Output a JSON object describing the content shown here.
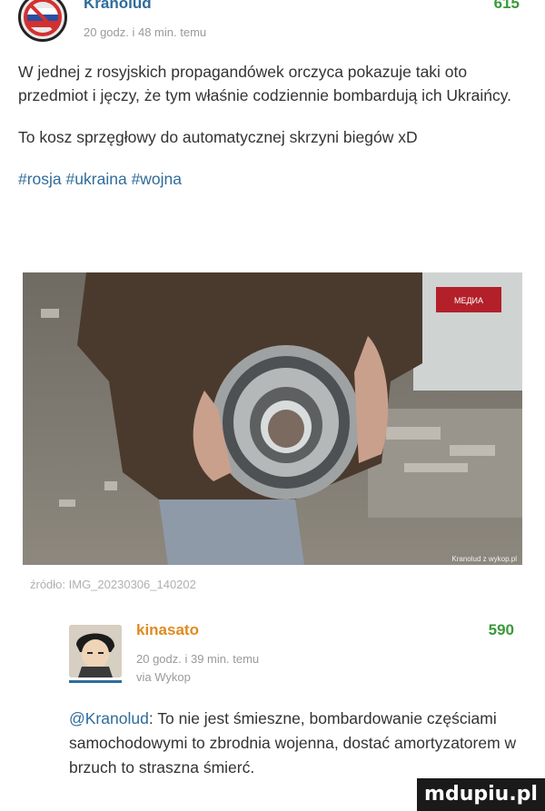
{
  "post": {
    "author": "Kranolud",
    "score": "615",
    "meta": "20 godz. i 48 min. temu",
    "paragraphs": [
      "W jednej z rosyjskich propagandówek orczyca pokazuje taki oto przedmiot i jęczy, że tym właśnie codziennie bombardują ich Ukraińcy.",
      "To kosz sprzęgłowy do automatycznej skrzyni biegów xD"
    ],
    "tags": [
      "#rosja",
      "#ukraina",
      "#wojna"
    ],
    "image": {
      "corner_logo_text": "МЕДИА",
      "watermark": "Kranolud z wykop.pl"
    },
    "source_caption": "źródło: IMG_20230306_140202"
  },
  "comment": {
    "author": "kinasato",
    "score": "590",
    "meta_time": "20 godz. i 39 min. temu",
    "meta_via": "via Wykop",
    "mention": "@Kranolud",
    "text": ": To nie jest śmieszne, bombardowanie częściami samochodowymi to zbrodnia wojenna, dostać amortyzatorem w brzuch to straszna śmierć."
  },
  "site_watermark": "mdupiu.pl",
  "colors": {
    "link": "#2f6c9a",
    "score": "#3a9a3a",
    "commenter": "#e08a1e"
  }
}
